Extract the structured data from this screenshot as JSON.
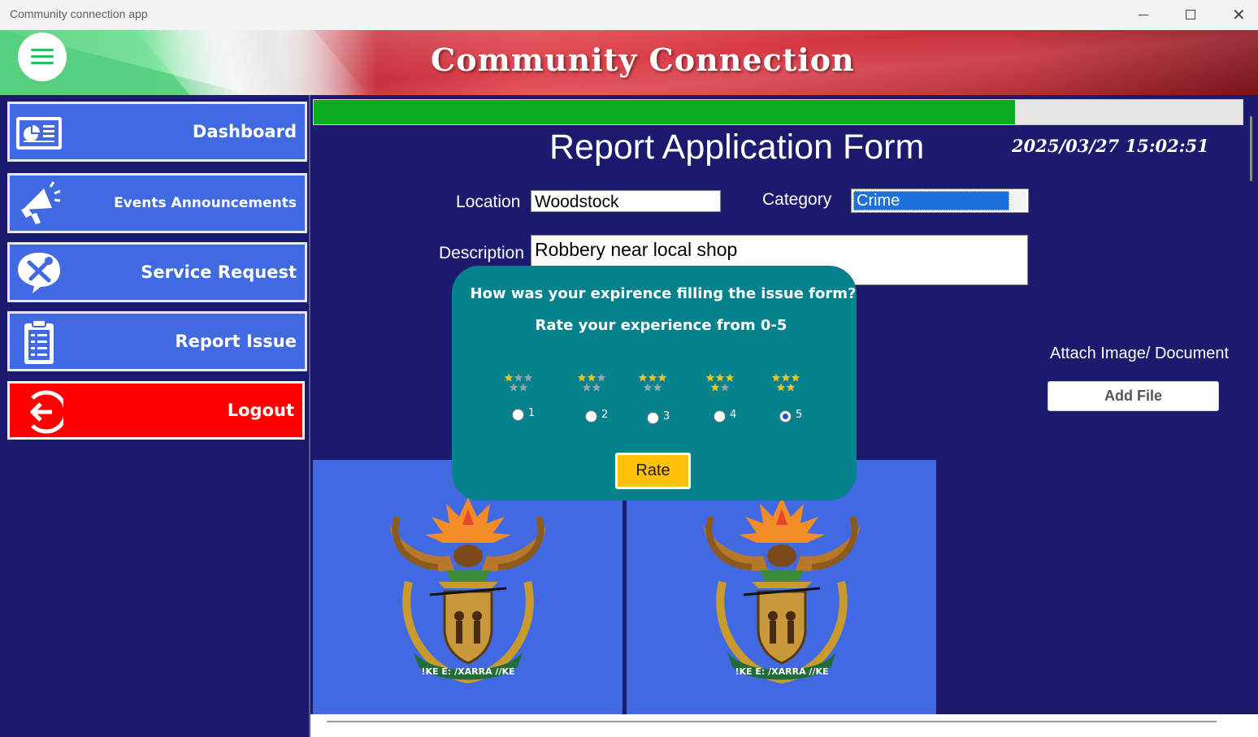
{
  "window": {
    "title": "Community connection app",
    "controls": [
      "minimize",
      "maximize",
      "close"
    ]
  },
  "header": {
    "app_title": "Community Connection",
    "menu_icon": "hamburger-menu-icon"
  },
  "sidebar": {
    "items": [
      {
        "label": "Dashboard",
        "icon": "dashboard-icon"
      },
      {
        "label": "Events Announcements",
        "icon": "megaphone-icon"
      },
      {
        "label": "Service Request",
        "icon": "tools-icon"
      },
      {
        "label": "Report Issue",
        "icon": "clipboard-icon"
      },
      {
        "label": "Logout",
        "icon": "logout-icon"
      }
    ]
  },
  "main": {
    "progress": 0.755,
    "form_title": "Report Application Form",
    "datetime": "2025/03/27 15:02:51",
    "location": {
      "label": "Location",
      "value": "Woodstock"
    },
    "category": {
      "label": "Category",
      "value": "Crime"
    },
    "description": {
      "label": "Description",
      "value": "Robbery near local shop"
    },
    "attach_label": "Attach Image/ Document",
    "add_file_label": "Add File"
  },
  "rating_dialog": {
    "question": "How was your expirence filling the issue form?",
    "subtitle": "Rate your experience from 0-5",
    "options": [
      {
        "label": "1",
        "stars": 1,
        "checked": false
      },
      {
        "label": "2",
        "stars": 2,
        "checked": false
      },
      {
        "label": "3",
        "stars": 3,
        "checked": false
      },
      {
        "label": "4",
        "stars": 4,
        "checked": false
      },
      {
        "label": "5",
        "stars": 5,
        "checked": true
      }
    ],
    "rate_label": "Rate"
  },
  "colors": {
    "background": "#1c1a6e",
    "nav_blue": "#4169e1",
    "logout_red": "#ff0000",
    "progress_green": "#0aab1e",
    "dialog_teal": "#06828c",
    "rate_yellow": "#ffc107",
    "star_gold": "#f5c518",
    "star_grey": "#9aa3ad"
  },
  "emblem_motto": "!KE E: /XARRA //KE"
}
